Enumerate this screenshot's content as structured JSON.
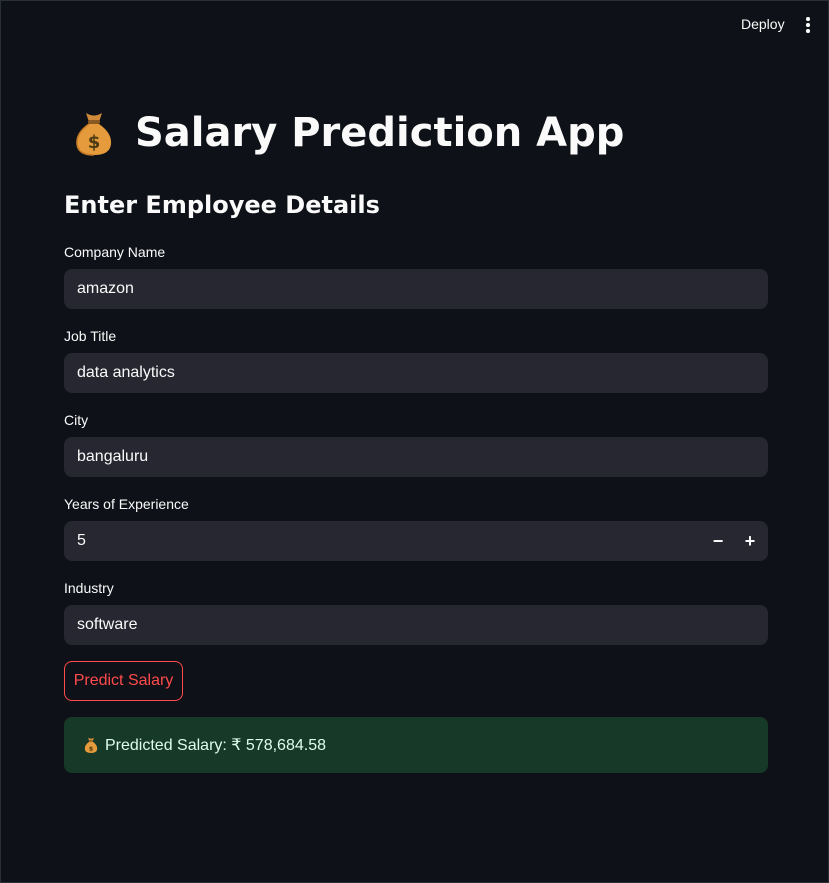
{
  "header": {
    "deploy_label": "Deploy",
    "menu_icon": "vertical-ellipsis-icon"
  },
  "page": {
    "title_icon": "money-bag-icon",
    "title": "Salary Prediction App",
    "subtitle": "Enter Employee Details"
  },
  "form": {
    "company": {
      "label": "Company Name",
      "value": "amazon"
    },
    "job_title": {
      "label": "Job Title",
      "value": "data analytics"
    },
    "city": {
      "label": "City",
      "value": "bangaluru"
    },
    "experience": {
      "label": "Years of Experience",
      "value": "5",
      "minus": "−",
      "plus": "+"
    },
    "industry": {
      "label": "Industry",
      "value": "software"
    },
    "predict_label": "Predict Salary"
  },
  "result": {
    "icon": "money-bag-icon",
    "text": "Predicted Salary: ₹ 578,684.58"
  },
  "colors": {
    "background": "#0e1117",
    "input_bg": "#262730",
    "accent": "#ff4b4b",
    "success_bg": "#173928",
    "success_text": "#dffde9"
  }
}
